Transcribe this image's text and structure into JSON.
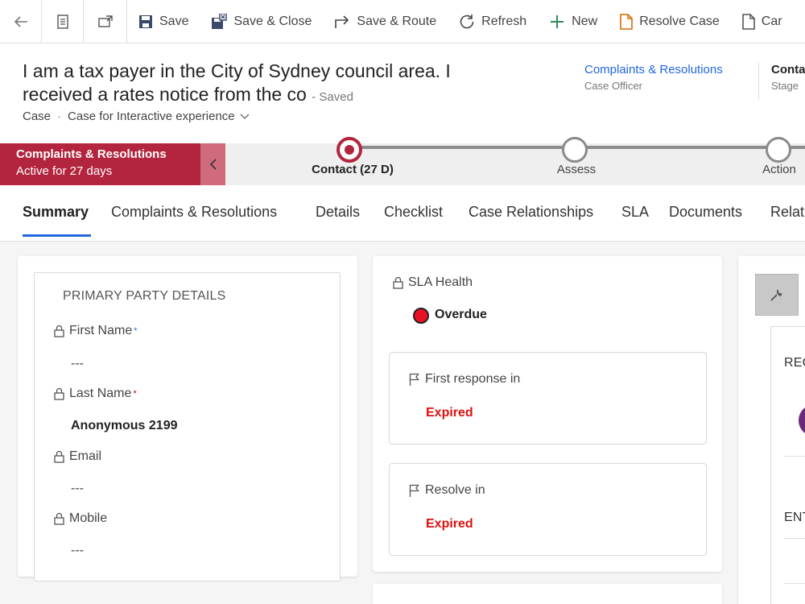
{
  "toolbar": {
    "save": "Save",
    "save_close": "Save & Close",
    "save_route": "Save & Route",
    "refresh": "Refresh",
    "new": "New",
    "resolve_case": "Resolve Case",
    "cancel_truncated": "Car"
  },
  "header": {
    "title_line1": "I am a tax payer in the City of Sydney council area. I",
    "title_line2": "received a rates notice from the co",
    "saved_status": "- Saved",
    "entity": "Case",
    "form": "Case for Interactive experience",
    "field1_value": "Complaints & Resolutions",
    "field1_label": "Case Officer",
    "field2_value": "Conta",
    "field2_label": "Stage"
  },
  "bpf": {
    "active_process": "Complaints & Resolutions",
    "active_duration": "Active for 27 days",
    "stages": [
      {
        "label": "Contact  (27 D)"
      },
      {
        "label": "Assess"
      },
      {
        "label": "Action"
      }
    ]
  },
  "tabs": [
    "Summary",
    "Complaints & Resolutions",
    "Details",
    "Checklist",
    "Case Relationships",
    "SLA",
    "Documents",
    "Relat"
  ],
  "primary_party": {
    "title": "PRIMARY PARTY DETAILS",
    "first_name_label": "First Name",
    "first_name_value": "---",
    "last_name_label": "Last Name",
    "last_name_value": "Anonymous 2199",
    "email_label": "Email",
    "email_value": "---",
    "mobile_label": "Mobile",
    "mobile_value": "---"
  },
  "sla": {
    "health_label": "SLA Health",
    "health_value": "Overdue",
    "health_color": "#e81123",
    "first_response_label": "First response in",
    "first_response_value": "Expired",
    "resolve_label": "Resolve in",
    "resolve_value": "Expired"
  },
  "right_panel": {
    "section1": "REC",
    "section2": "ENT"
  },
  "colors": {
    "accent": "#2266dd",
    "process": "#b3253f",
    "expired": "#e01010"
  }
}
